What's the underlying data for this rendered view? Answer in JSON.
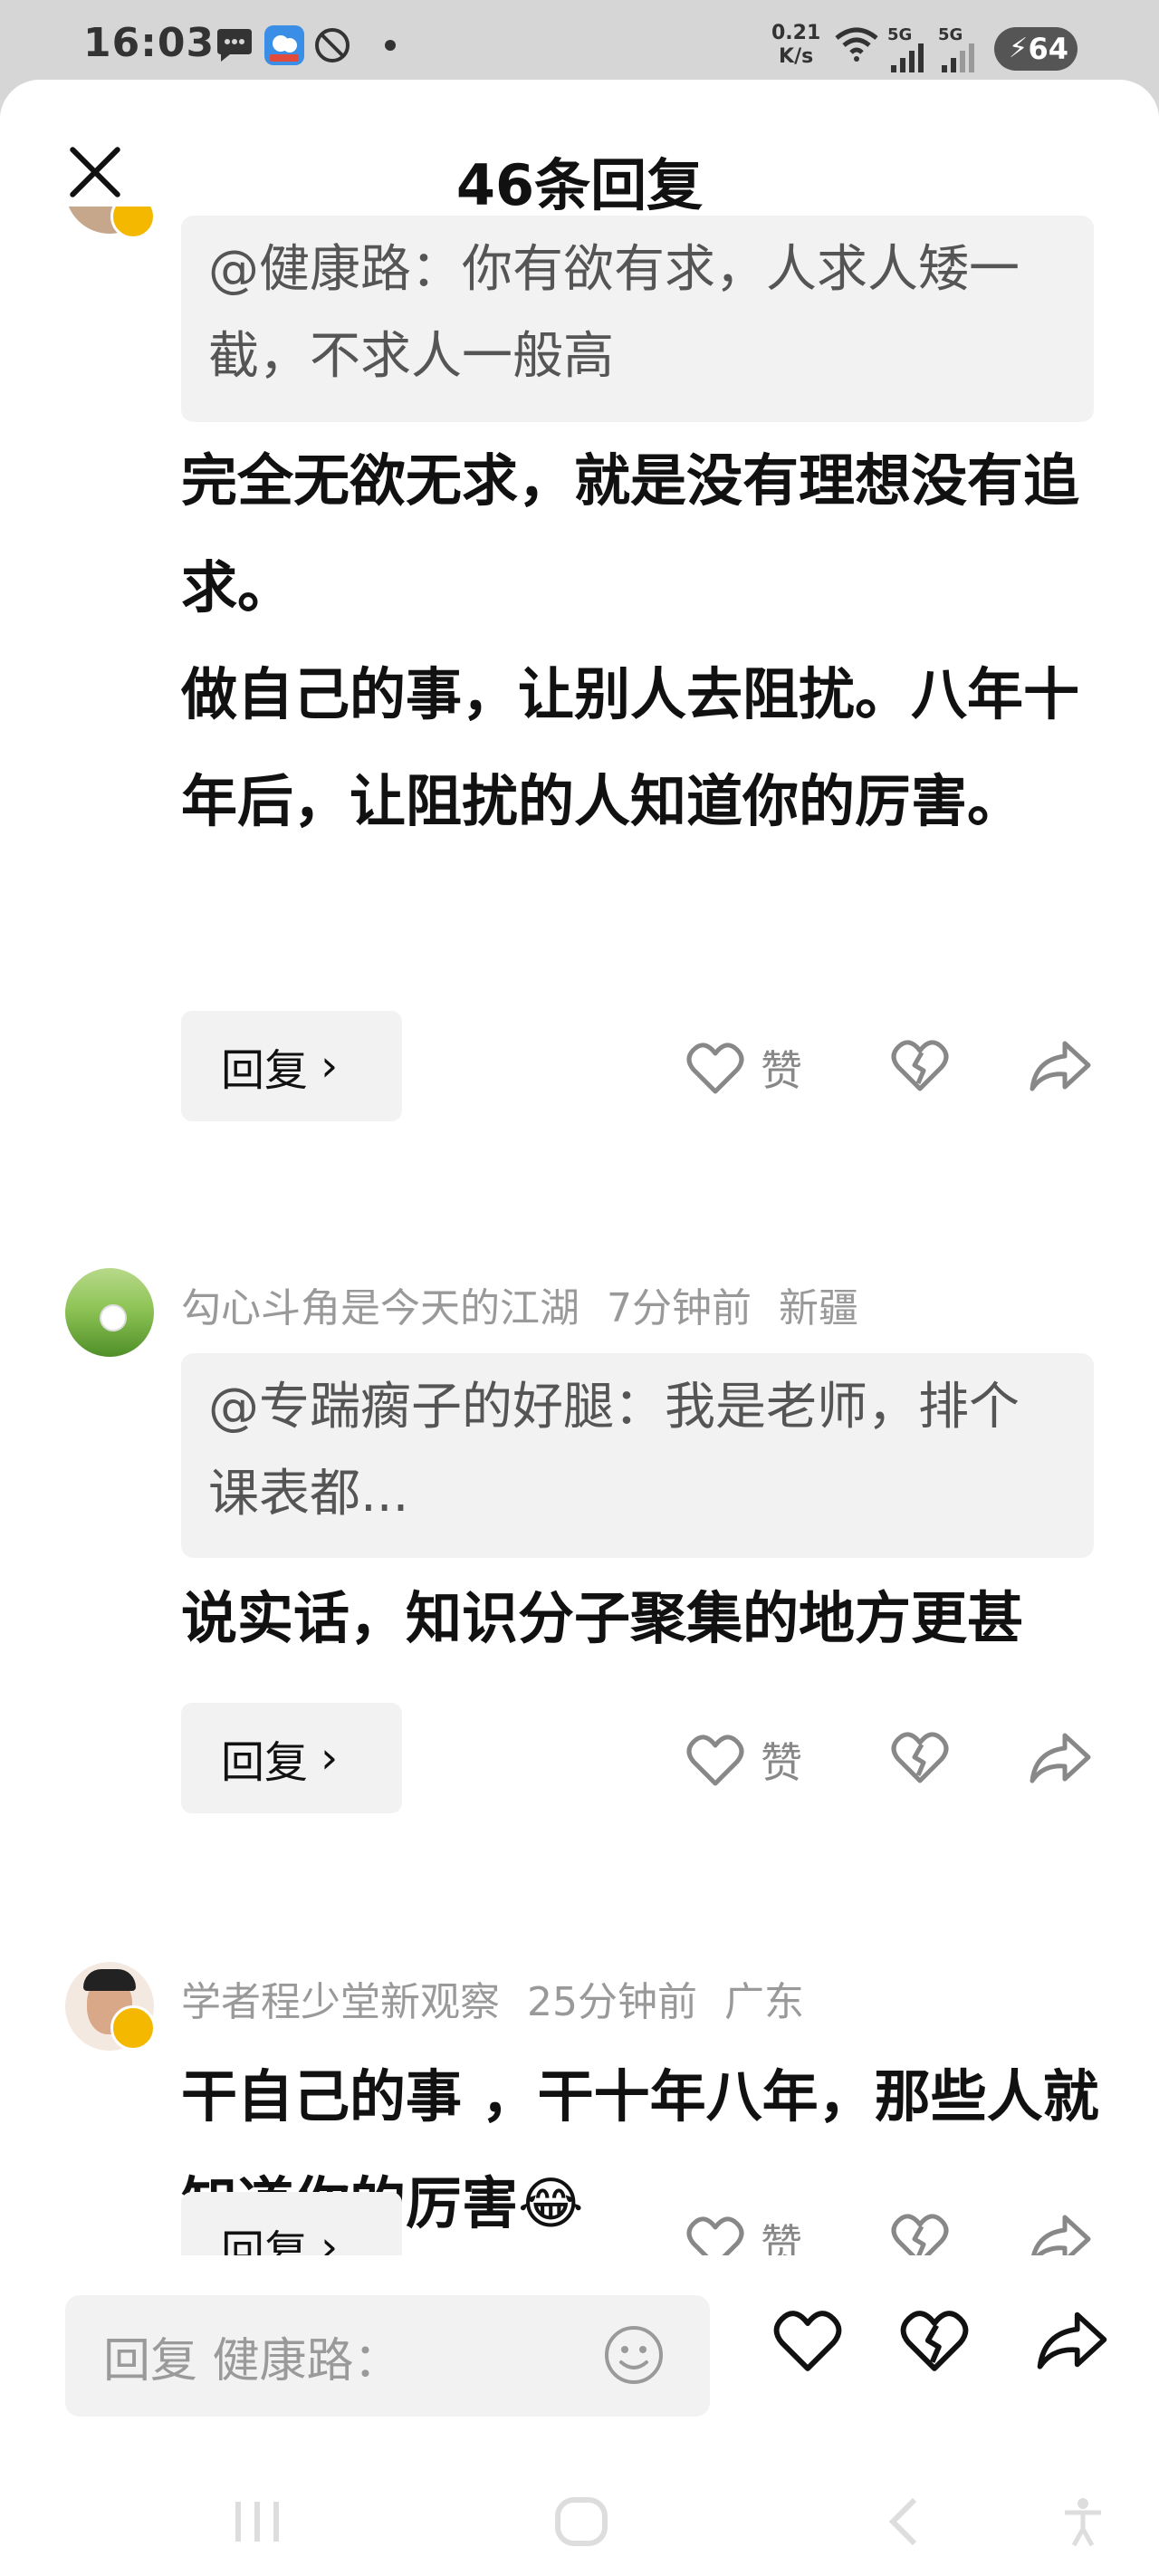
{
  "status_bar": {
    "time": "16:03",
    "speed_value": "0.21",
    "speed_unit": "K/s",
    "signal1": "5G",
    "signal2": "5G",
    "battery": "64"
  },
  "header": {
    "title": "46条回复"
  },
  "partial_comment": {
    "quote": "@健康路：你有欲有求，人求人矮一截，不求人一般高",
    "body_lines": [
      "完全无欲无求，就是没有理想没有追求。",
      "做自己的事，让别人去阻扰。八年十年后，让阻扰的人知道你的厉害。"
    ]
  },
  "comments": [
    {
      "author": "勾心斗角是今天的江湖",
      "time": "7分钟前",
      "location": "新疆",
      "quote": "@专踹瘸子的好腿：我是老师，排个课表都...",
      "body": "说实话，知识分子聚集的地方更甚"
    },
    {
      "author": "学者程少堂新观察",
      "time": "25分钟前",
      "location": "广东",
      "body": "干自己的事 ，干十年八年，那些人就知道你的厉害😂"
    }
  ],
  "actions": {
    "reply_label": "回复",
    "like_label": "赞"
  },
  "bottom_bar": {
    "input_placeholder": "回复 健康路："
  },
  "colors": {
    "like_gray": "#888888",
    "meta_gray": "#999999",
    "bubble": "#f2f2f2",
    "badge": "#f5b800"
  }
}
